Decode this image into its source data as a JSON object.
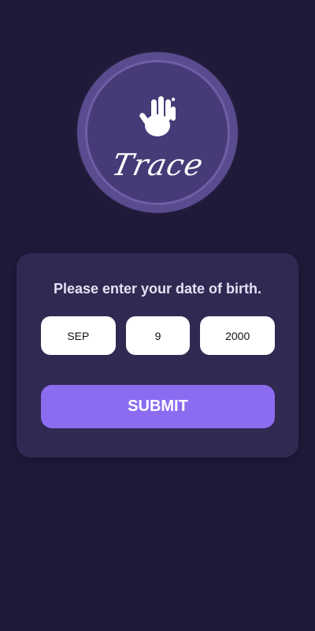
{
  "app": {
    "brand_name": "Trace",
    "icons": {
      "logo_mark": "hand-icon"
    }
  },
  "dob_form": {
    "prompt": "Please enter your date of birth.",
    "month": "SEP",
    "day": "9",
    "year": "2000",
    "submit_label": "SUBMIT"
  },
  "colors": {
    "background": "#1f1a3a",
    "card": "#302a52",
    "logo_ring": "#5a4b8f",
    "logo_inner": "#463a77",
    "logo_border": "#6e5ea6",
    "accent": "#8b6cf0"
  }
}
